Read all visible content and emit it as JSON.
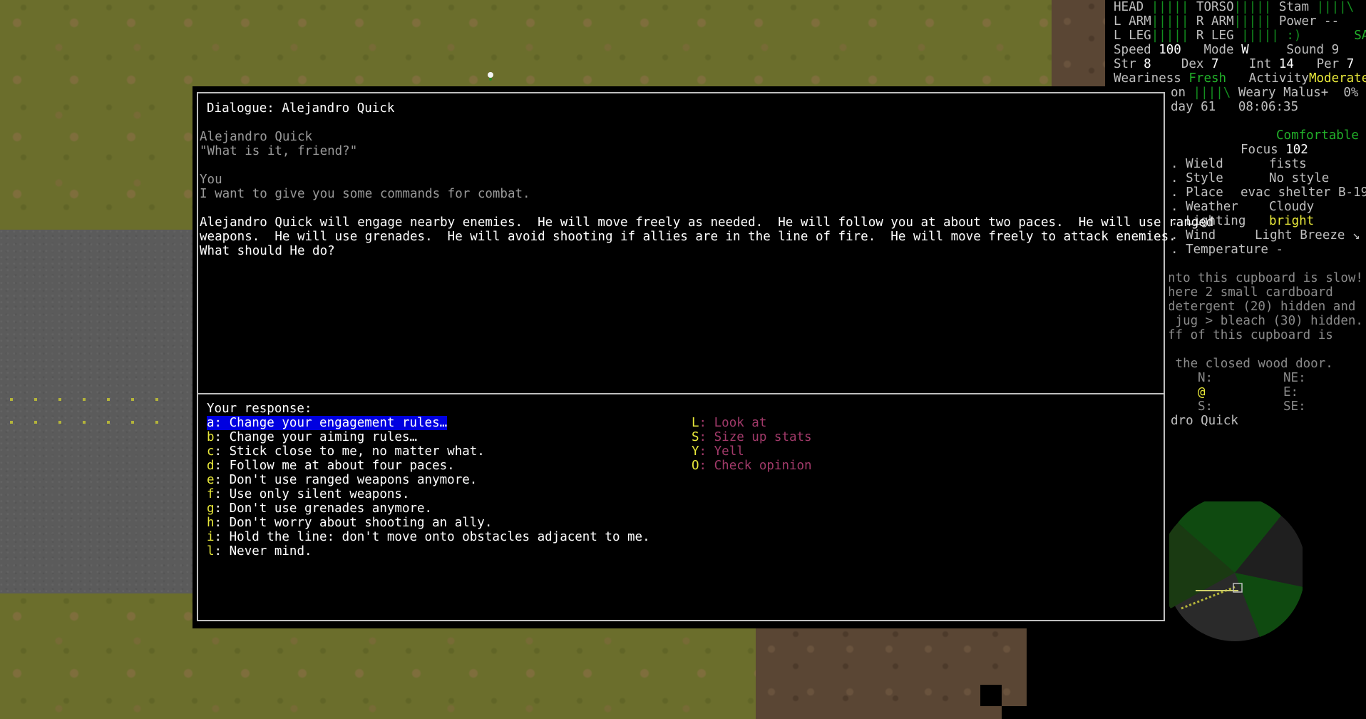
{
  "dialogue": {
    "title": "Dialogue: Alejandro Quick",
    "log": [
      {
        "kind": "speaker",
        "text": "Alejandro Quick"
      },
      {
        "kind": "speech",
        "text": "\"What is it, friend?\""
      },
      {
        "kind": "blank",
        "text": ""
      },
      {
        "kind": "speaker",
        "text": "You"
      },
      {
        "kind": "speech",
        "text": "I want to give you some commands for combat."
      },
      {
        "kind": "blank",
        "text": ""
      },
      {
        "kind": "narr",
        "text": "Alejandro Quick will engage nearby enemies.  He will move freely as needed.  He will follow you at about two paces.  He will use ranged"
      },
      {
        "kind": "narr",
        "text": "weapons.  He will use grenades.  He will avoid shooting if allies are in the line of fire.  He will move freely to attack enemies."
      },
      {
        "kind": "narr",
        "text": "What should He do?"
      }
    ],
    "response_label": "Your response:",
    "responses": [
      {
        "key": "a",
        "text": ": Change your engagement rules…",
        "selected": true
      },
      {
        "key": "b",
        "text": ": Change your aiming rules…",
        "selected": false
      },
      {
        "key": "c",
        "text": ": Stick close to me, no matter what.",
        "selected": false
      },
      {
        "key": "d",
        "text": ": Follow me at about four paces.",
        "selected": false
      },
      {
        "key": "e",
        "text": ": Don't use ranged weapons anymore.",
        "selected": false
      },
      {
        "key": "f",
        "text": ": Use only silent weapons.",
        "selected": false
      },
      {
        "key": "g",
        "text": ": Don't use grenades anymore.",
        "selected": false
      },
      {
        "key": "h",
        "text": ": Don't worry about shooting an ally.",
        "selected": false
      },
      {
        "key": "i",
        "text": ": Hold the line: don't move onto obstacles adjacent to me.",
        "selected": false
      },
      {
        "key": "l",
        "text": ": Never mind.",
        "selected": false
      }
    ],
    "actions": [
      {
        "key": "L",
        "text": ": Look at"
      },
      {
        "key": "S",
        "text": ": Size up stats"
      },
      {
        "key": "Y",
        "text": ": Yell"
      },
      {
        "key": "O",
        "text": ": Check opinion"
      }
    ]
  },
  "sidebar": {
    "r1": {
      "head": "HEAD",
      "head_bar": "|||||",
      "torso": "TORSO",
      "torso_bar": "|||||",
      "stam": "Stam",
      "stam_bar": "||||\\"
    },
    "r2": {
      "larm": "L ARM",
      "larm_bar": "|||||",
      "rarm": "R ARM",
      "rarm_bar": "|||||",
      "power": "Power --"
    },
    "r3": {
      "lleg": "L LEG",
      "lleg_bar": "|||||",
      "rleg": "R LEG",
      "rleg_bar": "|||||",
      "mood": ":)",
      "safe": "SAFE"
    },
    "r4": {
      "speed_l": "Speed",
      "speed_v": "100",
      "mode_l": "Mode",
      "mode_v": "W",
      "sound": "Sound 9"
    },
    "r5": {
      "str_l": "Str",
      "str_v": "8",
      "dex_l": "Dex",
      "dex_v": "7",
      "int_l": "Int",
      "int_v": "14",
      "per_l": "Per",
      "per_v": "7"
    },
    "r6": {
      "wear_l": "Weariness",
      "wear_v": "Fresh",
      "act_l": "Activity",
      "act_v": "Moderate"
    },
    "r7": {
      "on": "on",
      "on_bar": "||||\\",
      "malus": "Weary Malus+  0%"
    },
    "r8": {
      "day": "day 61",
      "time": "08:06:35"
    },
    "comfort": "Comfortable",
    "focus_l": "Focus",
    "focus_v": "102",
    "wield_l": ". Wield",
    "wield_v": "fists",
    "style_l": ". Style",
    "style_v": "No style",
    "place_l": ". Place",
    "place_v": "evac shelter B-19",
    "weather_l": ". Weather",
    "weather_v": "Cloudy",
    "light_l": ". Lighting",
    "light_v": "bright",
    "wind_l": ". Wind",
    "wind_v": "Light Breeze ↘",
    "temp_l": ". Temperature -",
    "msg1": "nto this cupboard is slow!",
    "msg2": "here 2 small cardboard",
    "msg3": "detergent (20) hidden and",
    "msg4": " jug > bleach (30) hidden.",
    "msg5": "ff of this cupboard is",
    "msg6": " the closed wood door.",
    "dir_n": "N:",
    "dir_ne": "NE:",
    "dir_at": "@",
    "dir_e": "E:",
    "dir_s": "S:",
    "dir_se": "SE:",
    "npc": "dro Quick"
  },
  "colors": {
    "selection": "#0000e0",
    "hotkey": "#e9e93a",
    "action_text": "#a23a6a",
    "grass": "#6b6e2c",
    "dirt": "#5a4634",
    "road": "#5b5b5b",
    "good_status": "#22b22a"
  }
}
